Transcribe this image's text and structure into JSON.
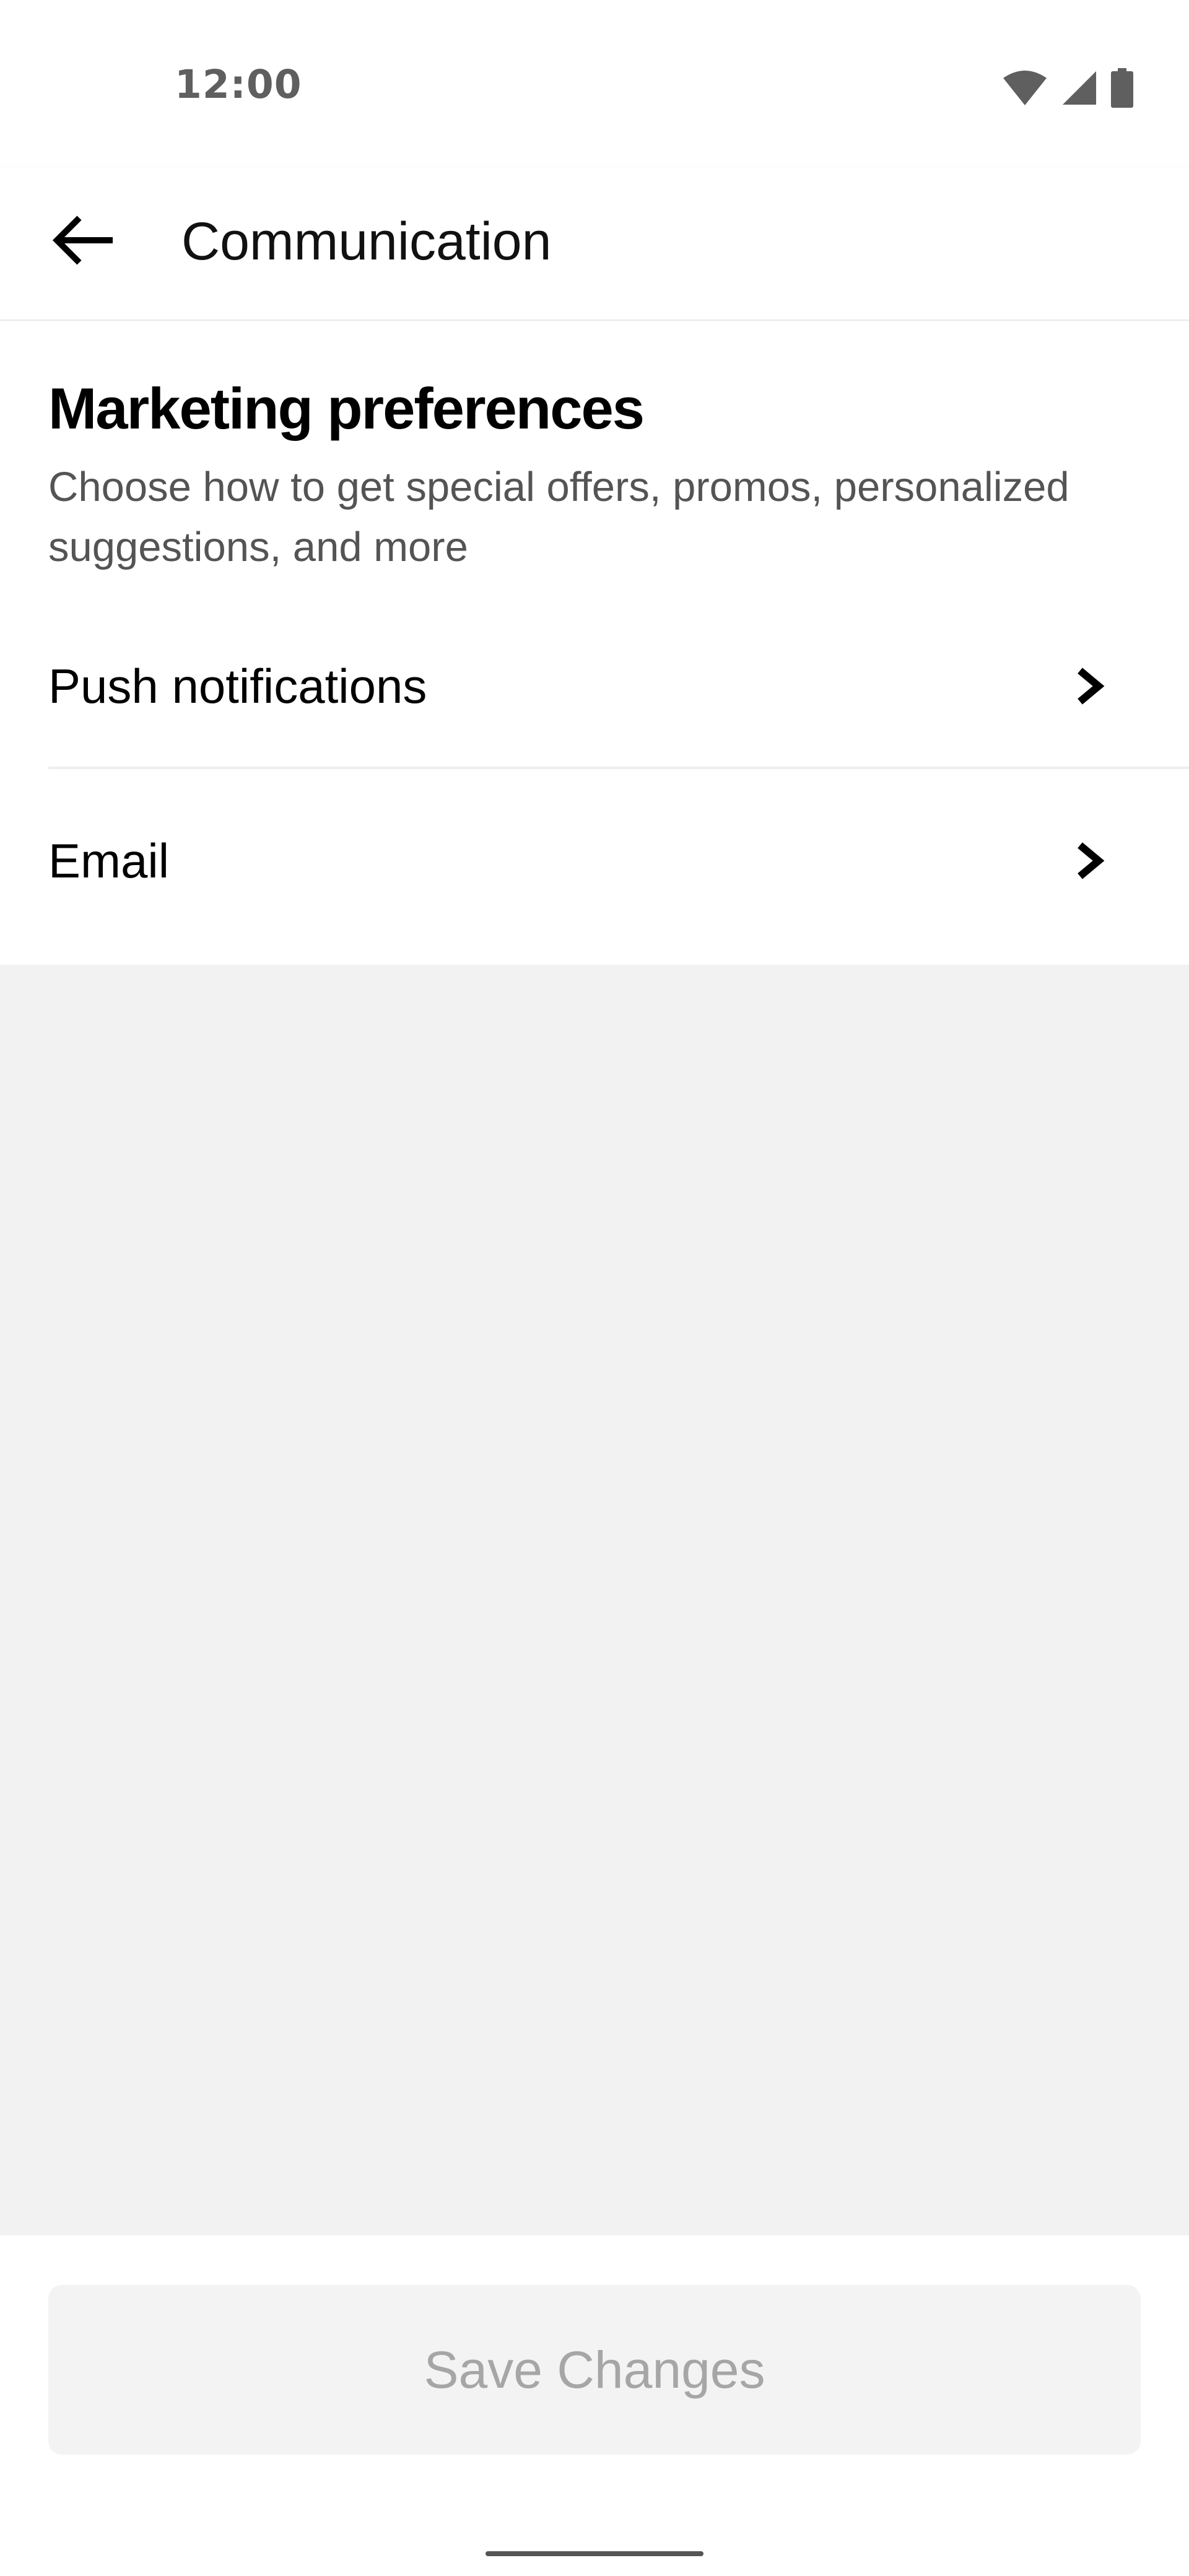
{
  "status_bar": {
    "time": "12:00",
    "icons": [
      "wifi-icon",
      "cell-signal-icon",
      "battery-icon"
    ]
  },
  "app_bar": {
    "title": "Communication",
    "back_icon": "arrow-left-icon"
  },
  "marketing": {
    "title": "Marketing preferences",
    "subtitle": "Choose how to get special offers, promos, personalized suggestions, and more",
    "items": [
      {
        "label": "Push notifications",
        "icon": "chevron-right-icon"
      },
      {
        "label": "Email",
        "icon": "chevron-right-icon"
      }
    ]
  },
  "footer": {
    "save_label": "Save Changes",
    "save_enabled": false
  },
  "colors": {
    "background": "#ffffff",
    "empty_area": "#f2f2f2",
    "subtitle_text": "#545454",
    "disabled_button_bg": "#f3f3f3",
    "disabled_button_text": "#a6a6a6"
  }
}
